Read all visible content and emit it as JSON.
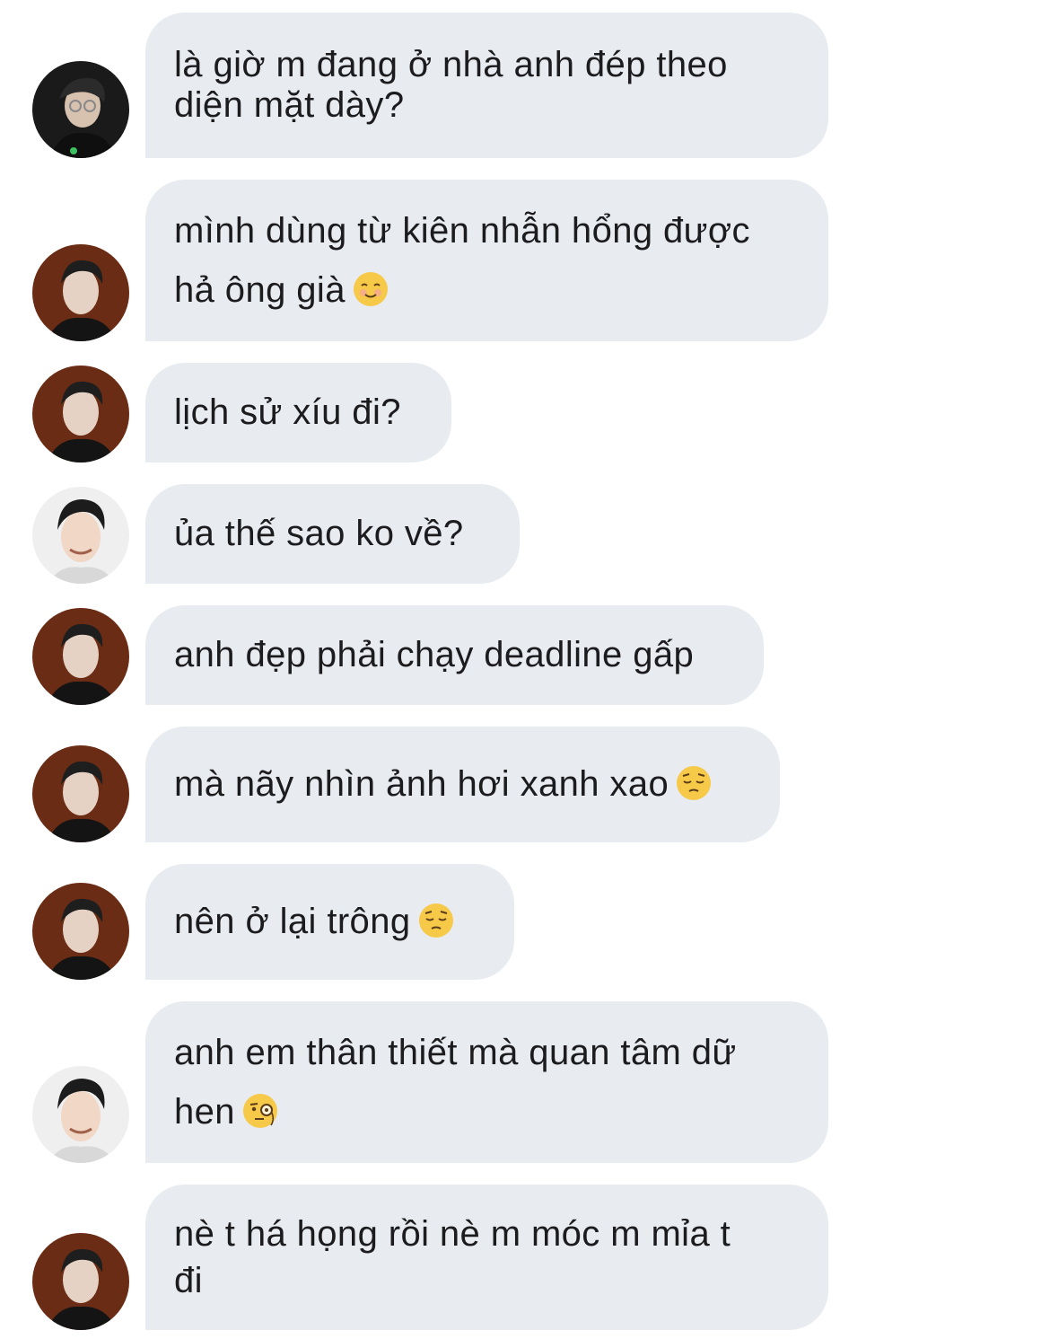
{
  "messages": [
    {
      "sender": "avatar-a",
      "line1": "là giờ m đang ở nhà anh đép theo",
      "line2": "diện mặt dày?",
      "emoji": ""
    },
    {
      "sender": "avatar-b",
      "line1": "mình dùng từ kiên nhẫn hổng được",
      "line2": "hả ông già",
      "emoji": "smiling-face-icon"
    },
    {
      "sender": "avatar-b",
      "line1": "lịch sử xíu đi?",
      "line2": "",
      "emoji": ""
    },
    {
      "sender": "avatar-c",
      "line1": "ủa thế sao ko về?",
      "line2": "",
      "emoji": ""
    },
    {
      "sender": "avatar-b",
      "line1": "anh đẹp phải chạy deadline gấp",
      "line2": "",
      "emoji": ""
    },
    {
      "sender": "avatar-b",
      "line1": "mà nãy nhìn ảnh hơi xanh xao",
      "line2": "",
      "emoji": "pensive-face-icon"
    },
    {
      "sender": "avatar-b",
      "line1": "nên ở lại trông",
      "line2": "",
      "emoji": "pensive-face-icon"
    },
    {
      "sender": "avatar-c",
      "line1": "anh em thân thiết mà quan tâm dữ",
      "line2": "hen",
      "emoji": "monocle-face-icon"
    },
    {
      "sender": "avatar-b",
      "line1": "nè t há họng rồi nè m móc m mỉa t",
      "line2": "đi",
      "emoji": ""
    }
  ],
  "colors": {
    "bubble": "#e8ebf0",
    "text": "#1c1c1e",
    "emoji_yellow": "#f7c948"
  }
}
